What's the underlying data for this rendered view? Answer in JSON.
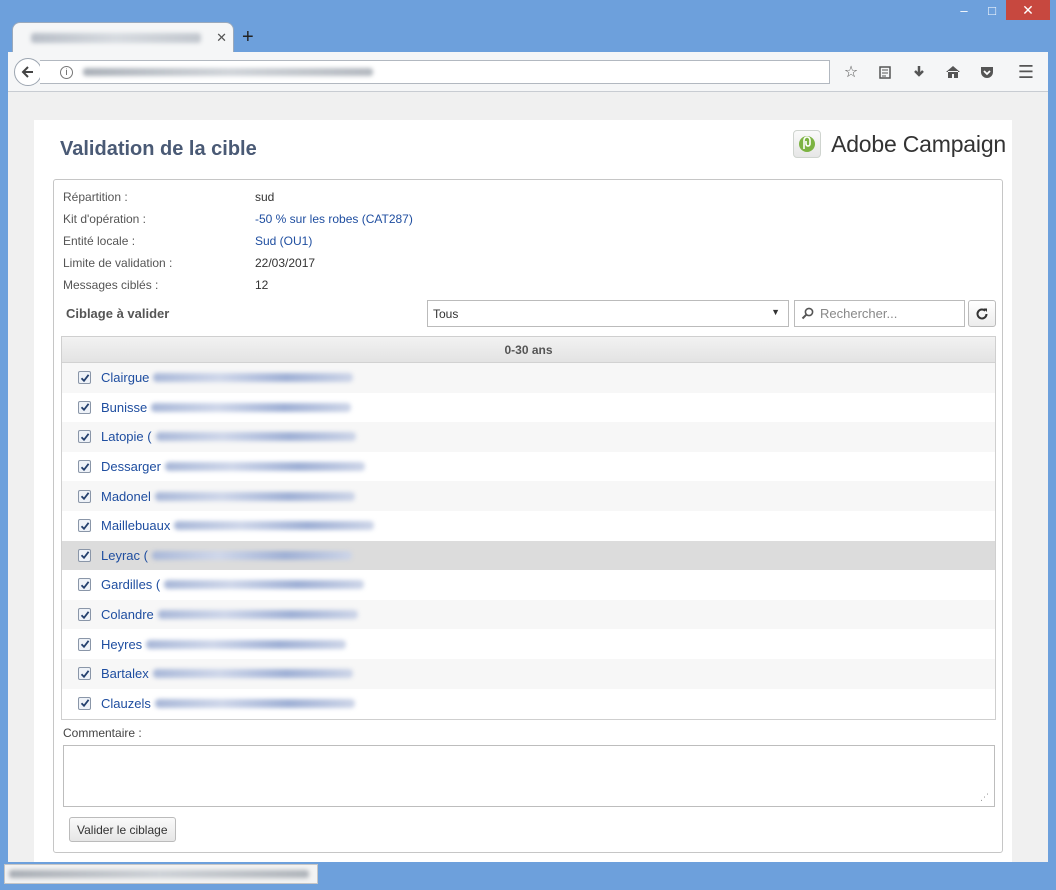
{
  "browser": {
    "new_tab_label": "+",
    "window_controls": {
      "minimize": "–",
      "maximize": "□",
      "close": "✕"
    }
  },
  "page": {
    "title": "Validation de la cible",
    "brand": "Adobe Campaign"
  },
  "info": [
    {
      "label": "Répartition :",
      "value": "sud",
      "link": false
    },
    {
      "label": "Kit d'opération :",
      "value": "-50 % sur les robes (CAT287)",
      "link": true
    },
    {
      "label": "Entité locale :",
      "value": "Sud (OU1)",
      "link": true
    },
    {
      "label": "Limite de validation :",
      "value": "22/03/2017",
      "link": false
    },
    {
      "label": "Messages ciblés :",
      "value": "12",
      "link": false
    }
  ],
  "targeting": {
    "label": "Ciblage à valider",
    "filter_selected": "Tous",
    "search_placeholder": "Rechercher..."
  },
  "group": {
    "title": "0-30 ans",
    "rows": [
      {
        "name": "Clairgue",
        "checked": true
      },
      {
        "name": "Bunisse",
        "checked": true
      },
      {
        "name": "Latopie (",
        "checked": true
      },
      {
        "name": "Dessarger",
        "checked": true
      },
      {
        "name": "Madonel",
        "checked": true
      },
      {
        "name": "Maillebuaux",
        "checked": true
      },
      {
        "name": "Leyrac (",
        "checked": true,
        "highlight": true
      },
      {
        "name": "Gardilles (",
        "checked": true
      },
      {
        "name": "Colandre",
        "checked": true
      },
      {
        "name": "Heyres",
        "checked": true
      },
      {
        "name": "Bartalex",
        "checked": true
      },
      {
        "name": "Clauzels",
        "checked": true
      }
    ]
  },
  "comment": {
    "label": "Commentaire :"
  },
  "actions": {
    "submit_label": "Valider le ciblage"
  },
  "colors": {
    "link": "#1f4ea0",
    "title": "#4a5a75",
    "window_frame": "#6da0dc",
    "close_button": "#c7483f"
  }
}
